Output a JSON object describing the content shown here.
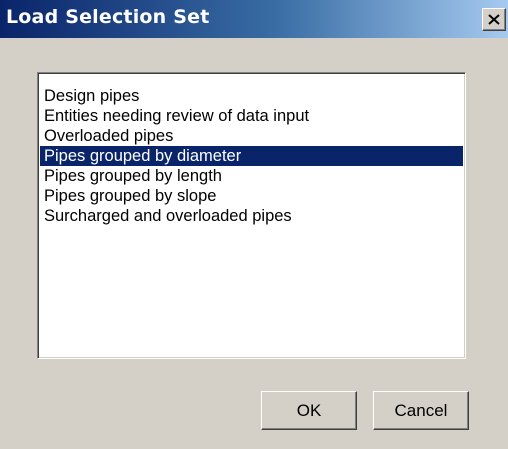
{
  "window": {
    "title": "Load Selection Set",
    "close_label": "close"
  },
  "list": {
    "items": [
      {
        "label": "Design pipes",
        "selected": false
      },
      {
        "label": "Entities needing review of data input",
        "selected": false
      },
      {
        "label": "Overloaded pipes",
        "selected": false
      },
      {
        "label": "Pipes grouped by diameter",
        "selected": true
      },
      {
        "label": "Pipes grouped by length",
        "selected": false
      },
      {
        "label": "Pipes grouped by slope",
        "selected": false
      },
      {
        "label": "Surcharged and overloaded pipes",
        "selected": false
      }
    ]
  },
  "buttons": {
    "ok_label": "OK",
    "cancel_label": "Cancel"
  },
  "colors": {
    "title_bar_start": "#0a246a",
    "title_bar_end": "#a6caf0",
    "selection_bg": "#0a246a",
    "dialog_bg": "#d4d0c8"
  }
}
